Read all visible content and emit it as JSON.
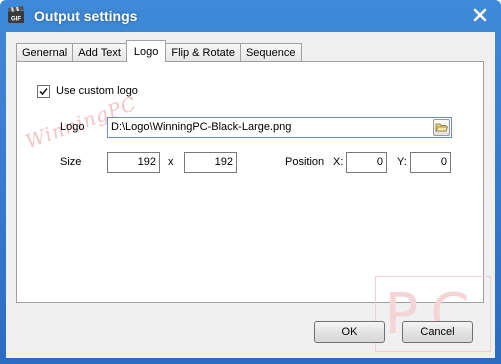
{
  "window": {
    "title": "Output settings",
    "app_icon": "clapperboard-gif-icon",
    "close_icon": "close-icon",
    "accent": "#2f74cc"
  },
  "tabs": [
    {
      "label": "Genernal",
      "active": false
    },
    {
      "label": "Add Text",
      "active": false
    },
    {
      "label": "Logo",
      "active": true
    },
    {
      "label": "Flip & Rotate",
      "active": false
    },
    {
      "label": "Sequence",
      "active": false
    }
  ],
  "logo": {
    "use_custom_label": "Use custom logo",
    "use_custom_checked": true,
    "logo_label": "Logo",
    "logo_path": "D:\\Logo\\WinningPC-Black-Large.png",
    "browse_icon": "folder-open-icon",
    "size_label": "Size",
    "width": "192",
    "x_label": "x",
    "height": "192",
    "position_label": "Position",
    "pos_x_label": "X:",
    "pos_x": "0",
    "pos_y_label": "Y:",
    "pos_y": "0"
  },
  "buttons": {
    "ok": "OK",
    "cancel": "Cancel"
  },
  "watermarks": {
    "script": "WinningPC",
    "pc": "PC"
  }
}
